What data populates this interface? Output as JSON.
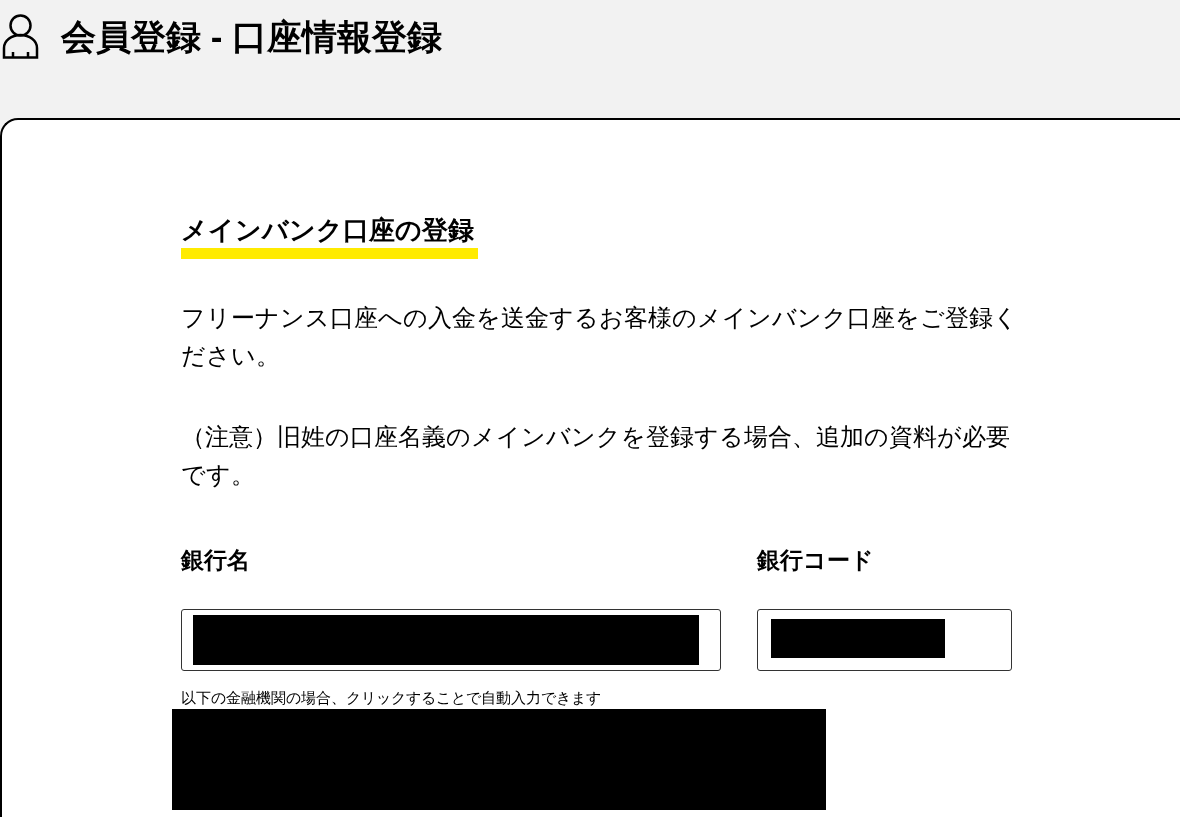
{
  "header": {
    "title": "会員登録 - 口座情報登録"
  },
  "section": {
    "heading": "メインバンク口座の登録",
    "paragraphs": [
      "フリーナンス口座への入金を送金するお客様のメインバンク口座をご登録ください。",
      "（注意）旧姓の口座名義のメインバンクを登録する場合、追加の資料が必要です。"
    ]
  },
  "fields": [
    {
      "label": "銀行名",
      "redacted": true
    },
    {
      "label": "銀行コード",
      "redacted": true
    }
  ],
  "hint": "以下の金融機関の場合、クリックすることで自動入力できます",
  "bank_shortcuts": {
    "redacted": true
  }
}
